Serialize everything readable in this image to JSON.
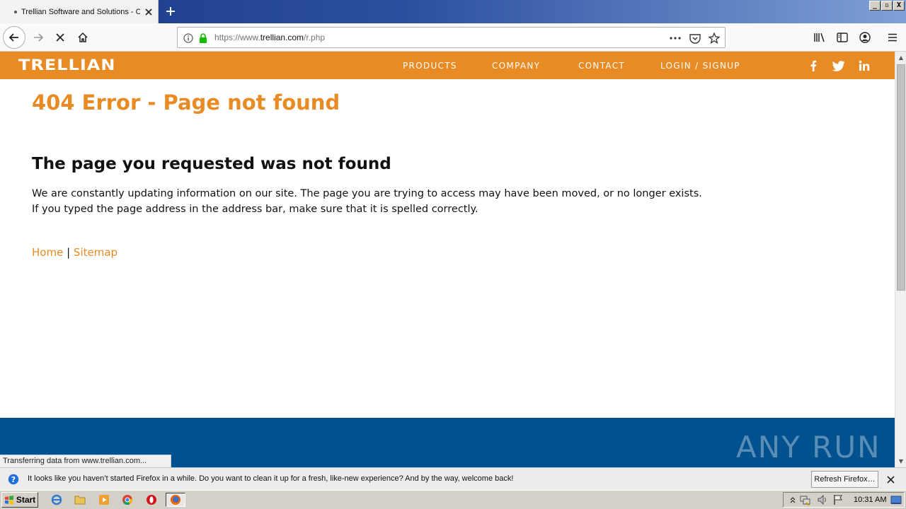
{
  "browser": {
    "tab_title": "Trellian Software and Solutions - C",
    "url_prefix": "https://www.",
    "url_domain": "trellian.com",
    "url_path": "/r.php",
    "window_controls": [
      "_",
      "▫",
      "X"
    ]
  },
  "site": {
    "logo": "TRELLIAN",
    "nav": [
      "PRODUCTS",
      "COMPANY",
      "CONTACT",
      "LOGIN / SIGNUP"
    ],
    "social_icons": [
      "facebook-icon",
      "twitter-icon",
      "linkedin-icon"
    ],
    "colors": {
      "orange": "#e88b24",
      "footer_blue": "#00518f"
    }
  },
  "content": {
    "error_heading": "404 Error - Page not found",
    "subheading": "The page you requested was not found",
    "paragraph_1": "We are constantly updating information on our site. The page you are trying to access may have been moved, or no longer exists.",
    "paragraph_2": "If you typed the page address in the address bar, make sure that it is spelled correctly.",
    "link_home": "Home",
    "link_separator": "|",
    "link_sitemap": "Sitemap"
  },
  "watermark": "ANY RUN",
  "status_text": "Transferring data from www.trellian.com...",
  "notification": {
    "text": "It looks like you haven’t started Firefox in a while. Do you want to clean it up for a fresh, like-new experience? And by the way, welcome back!",
    "button": "Refresh Firefox…"
  },
  "taskbar": {
    "start_label": "Start",
    "clock": "10:31 AM"
  }
}
